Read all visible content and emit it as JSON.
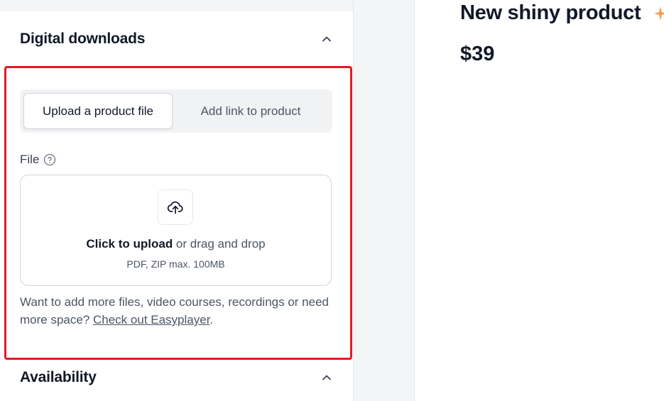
{
  "sections": {
    "digital_downloads": {
      "title": "Digital downloads"
    },
    "availability": {
      "title": "Availability"
    }
  },
  "tabs": {
    "upload": "Upload a product file",
    "link": "Add link to product"
  },
  "file": {
    "label": "File",
    "drop_strong": "Click to upload",
    "drop_rest": " or drag and drop",
    "hint": "PDF, ZIP max. 100MB"
  },
  "note": {
    "text": "Want to add more files, video courses, recordings or need more space? ",
    "link": "Check out Easyplayer",
    "end": "."
  },
  "preview": {
    "title": "New shiny product",
    "price": "$39"
  },
  "colors": {
    "highlight": "#e01b24",
    "sparkle": "#f4a261"
  },
  "icons": {
    "chevron": "chevron-up-icon",
    "help": "help-circle-icon",
    "upload": "cloud-upload-icon",
    "sparkle": "sparkle-icon"
  }
}
